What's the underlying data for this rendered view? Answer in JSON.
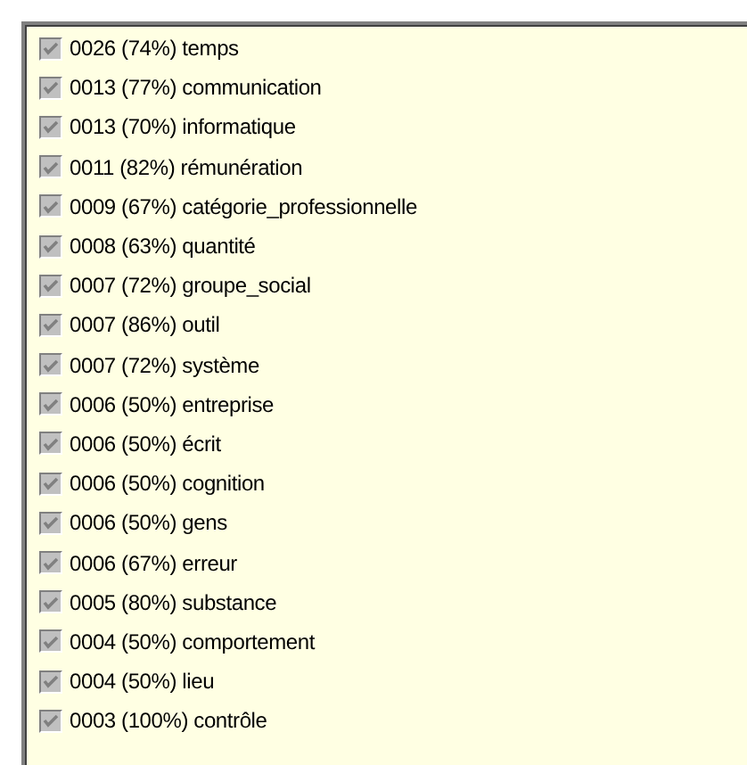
{
  "items": [
    {
      "label": "0026 (74%) temps",
      "checked": true
    },
    {
      "label": "0013 (77%) communication",
      "checked": true
    },
    {
      "label": "0013 (70%) informatique",
      "checked": true
    },
    {
      "label": "0011 (82%) rémunération",
      "checked": true
    },
    {
      "label": "0009 (67%) catégorie_professionnelle",
      "checked": true
    },
    {
      "label": "0008 (63%) quantité",
      "checked": true
    },
    {
      "label": "0007 (72%) groupe_social",
      "checked": true
    },
    {
      "label": "0007 (86%) outil",
      "checked": true
    },
    {
      "label": "0007 (72%) système",
      "checked": true
    },
    {
      "label": "0006 (50%) entreprise",
      "checked": true
    },
    {
      "label": "0006 (50%) écrit",
      "checked": true
    },
    {
      "label": "0006 (50%) cognition",
      "checked": true
    },
    {
      "label": "0006 (50%) gens",
      "checked": true
    },
    {
      "label": "0006 (67%) erreur",
      "checked": true
    },
    {
      "label": "0005 (80%) substance",
      "checked": true
    },
    {
      "label": "0004 (50%) comportement",
      "checked": true
    },
    {
      "label": "0004 (50%) lieu",
      "checked": true
    },
    {
      "label": "0003 (100%) contrôle",
      "checked": true
    }
  ]
}
